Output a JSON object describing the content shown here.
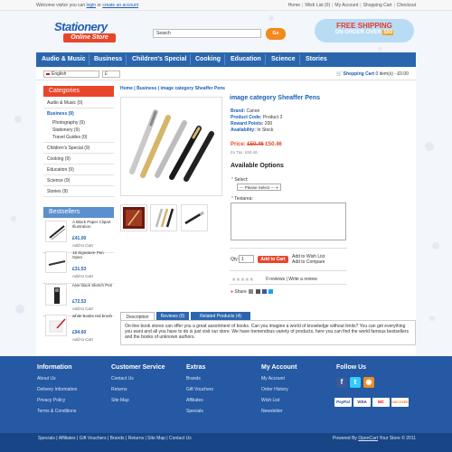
{
  "topbar": {
    "welcome_prefix": "Welcome visitor you can",
    "login": "login",
    "or": "or",
    "create_account": "create an account",
    "links": [
      "Home",
      "Wish List (0)",
      "My Account",
      "Shopping Cart",
      "Checkout"
    ]
  },
  "header": {
    "logo_line1": "Stationery",
    "logo_line2": "Online Store",
    "search_placeholder": "Search",
    "search_button": "Go",
    "ship_line1": "FREE SHIPPING",
    "ship_line2": "ON ORDER OVER",
    "ship_amount": "$80"
  },
  "nav": [
    "Audio & Music",
    "Business",
    "Children's Special",
    "Cooking",
    "Education",
    "Science",
    "Stories"
  ],
  "subbar": {
    "language": "English",
    "currency": "£",
    "cart_label": "Shopping Cart",
    "cart_info": "0 item(s) - £0.00"
  },
  "categories": {
    "title": "Categories",
    "items": [
      {
        "label": "Audio & Music (0)",
        "sub": []
      },
      {
        "label": "Business (9)",
        "active": true,
        "sub": [
          "Photography (9)",
          "Stationery (9)",
          "Travel Guides (0)"
        ]
      },
      {
        "label": "Children's Special (9)",
        "sub": []
      },
      {
        "label": "Cooking (9)",
        "sub": []
      },
      {
        "label": "Education (9)",
        "sub": []
      },
      {
        "label": "Science (9)",
        "sub": []
      },
      {
        "label": "Stories (9)",
        "sub": []
      }
    ]
  },
  "bestsellers": {
    "title": "Bestsellers",
    "items": [
      {
        "name": "A Black Paper Clipart Illustration",
        "price": "£41.00",
        "add": "Add to Cart"
      },
      {
        "name": "18 Signature Pen Open",
        "price": "£31.53",
        "add": "Add to Cart"
      },
      {
        "name": "new black Sketch Pen",
        "price": "£72.53",
        "add": "Add to Cart"
      },
      {
        "name": "white books red brush",
        "price": "£94.60",
        "add": "Add to Cart"
      }
    ]
  },
  "breadcrumb": [
    "Home",
    "Business",
    "image category Sheaffer Pens"
  ],
  "product": {
    "title": "image category Sheaffer Pens",
    "brand_label": "Brand:",
    "brand": "Canon",
    "code_label": "Product Code:",
    "code": "Product 3",
    "points_label": "Reward Points:",
    "points": "200",
    "avail_label": "Availability:",
    "avail": "In Stock",
    "price_label": "Price:",
    "old_price": "£50.46",
    "new_price": "£50.46",
    "ex_tax": "Ex Tax: £50.46",
    "options_title": "Available Options",
    "select_label": "Select:",
    "select_value": "--- Please Select ---",
    "textarea_label": "Textarea:",
    "qty_label": "Qty:",
    "qty": "1",
    "add_to_cart": "Add to Cart",
    "add_wishlist": "Add to Wish List",
    "add_compare": "Add to Compare",
    "stars": "★★★★★",
    "rating": 0,
    "reviews": "0 reviews",
    "write_review": "Write a review",
    "share": "Share"
  },
  "tabs": [
    "Description",
    "Reviews (0)",
    "Related Products (4)"
  ],
  "description": "On-line book stores can offer you a great assortment of books. Can you imagine a world of knowledge without limits? You can get everything you want and all you have to do is just visit our store. We have tremendous variety of products, here you can find the world famous bestsellers and the books of unknown authors.",
  "footer": {
    "columns": [
      {
        "title": "Information",
        "links": [
          "About Us",
          "Delivery Information",
          "Privacy Policy",
          "Terms & Conditions"
        ]
      },
      {
        "title": "Customer Service",
        "links": [
          "Contact Us",
          "Returns",
          "Site Map"
        ]
      },
      {
        "title": "Extras",
        "links": [
          "Brands",
          "Gift Vouchers",
          "Affiliates",
          "Specials"
        ]
      },
      {
        "title": "My Account",
        "links": [
          "My Account",
          "Order History",
          "Wish List",
          "Newsletter"
        ]
      }
    ],
    "follow_title": "Follow Us",
    "payments": [
      "PayPal",
      "VISA",
      "MC",
      "DISCOVER"
    ],
    "bottom_links": "Specials | Affiliates | Gift Vouchers | Brands | Returns | Site Map | Contact Us",
    "powered_prefix": "Powered By",
    "powered_link": "OpenCart",
    "powered_suffix": "Your Store © 2011"
  },
  "colors": {
    "brand_blue": "#2b66ad",
    "accent_red": "#e8462a",
    "footer_blue": "#2559a3"
  }
}
